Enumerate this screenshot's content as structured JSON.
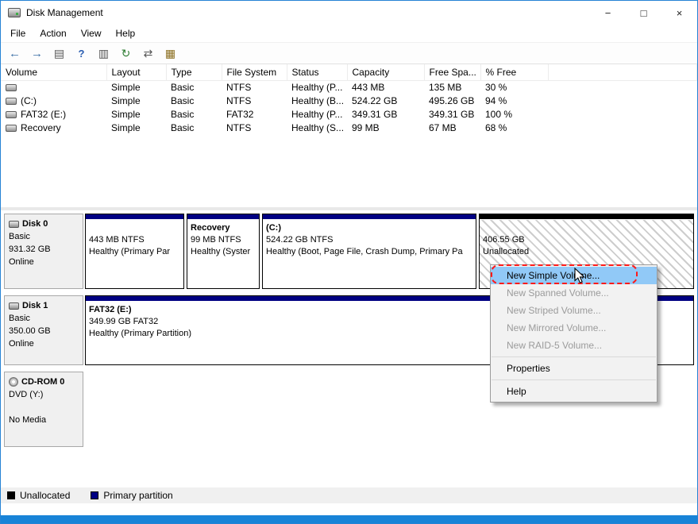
{
  "colors": {
    "accent": "#1883d7",
    "primary_partition": "#000082",
    "unallocated": "#000000",
    "menu_highlight": "#91c9f7",
    "annotation_red": "#ff1a1a"
  },
  "window": {
    "title": "Disk Management",
    "minimize": "−",
    "maximize": "□",
    "close": "×"
  },
  "menubar": {
    "items": [
      "File",
      "Action",
      "View",
      "Help"
    ]
  },
  "toolbar": {
    "icons": [
      {
        "name": "back-icon",
        "glyph": "←"
      },
      {
        "name": "forward-icon",
        "glyph": "→"
      },
      {
        "name": "show-console-tree-icon",
        "glyph": "▤"
      },
      {
        "name": "help-icon",
        "glyph": "?"
      },
      {
        "name": "show-action-pane-icon",
        "glyph": "▥"
      },
      {
        "name": "refresh-icon",
        "glyph": "↻"
      },
      {
        "name": "rescan-disks-icon",
        "glyph": "⇄"
      },
      {
        "name": "export-list-icon",
        "glyph": "▦"
      }
    ]
  },
  "volume_table": {
    "columns": [
      "Volume",
      "Layout",
      "Type",
      "File System",
      "Status",
      "Capacity",
      "Free Spa...",
      "% Free"
    ],
    "rows": [
      {
        "volume": "",
        "layout": "Simple",
        "type": "Basic",
        "file_system": "NTFS",
        "status": "Healthy (P...",
        "capacity": "443 MB",
        "free_space": "135 MB",
        "pct_free": "30 %"
      },
      {
        "volume": "(C:)",
        "layout": "Simple",
        "type": "Basic",
        "file_system": "NTFS",
        "status": "Healthy (B...",
        "capacity": "524.22 GB",
        "free_space": "495.26 GB",
        "pct_free": "94 %"
      },
      {
        "volume": "FAT32 (E:)",
        "layout": "Simple",
        "type": "Basic",
        "file_system": "FAT32",
        "status": "Healthy (P...",
        "capacity": "349.31 GB",
        "free_space": "349.31 GB",
        "pct_free": "100 %"
      },
      {
        "volume": "Recovery",
        "layout": "Simple",
        "type": "Basic",
        "file_system": "NTFS",
        "status": "Healthy (S...",
        "capacity": "99 MB",
        "free_space": "67 MB",
        "pct_free": "68 %"
      }
    ]
  },
  "disks": [
    {
      "name": "Disk 0",
      "info": [
        "Basic",
        "931.32 GB",
        "Online"
      ],
      "partitions": [
        {
          "label": "",
          "size": "443 MB NTFS",
          "status": "Healthy (Primary Par",
          "bar_color": "#000082"
        },
        {
          "label": "Recovery",
          "size": "99 MB NTFS",
          "status": "Healthy (Syster",
          "bar_color": "#000082"
        },
        {
          "label": "(C:)",
          "size": "524.22 GB NTFS",
          "status": "Healthy (Boot, Page File, Crash Dump, Primary Pa",
          "bar_color": "#000082"
        },
        {
          "label": "",
          "size": "406.55 GB",
          "status": "Unallocated",
          "bar_color": "#000000"
        }
      ]
    },
    {
      "name": "Disk 1",
      "info": [
        "Basic",
        "350.00 GB",
        "Online"
      ],
      "partitions": [
        {
          "label": "FAT32 (E:)",
          "size": "349.99 GB FAT32",
          "status": "Healthy (Primary Partition)",
          "bar_color": "#000082"
        }
      ]
    },
    {
      "name": "CD-ROM 0",
      "info": [
        "DVD (Y:)",
        "",
        "No Media"
      ],
      "partitions": []
    }
  ],
  "context_menu": {
    "items": [
      {
        "label": "New Simple Volume...",
        "state": "highlighted"
      },
      {
        "label": "New Spanned Volume...",
        "state": "disabled"
      },
      {
        "label": "New Striped Volume...",
        "state": "disabled"
      },
      {
        "label": "New Mirrored Volume...",
        "state": "disabled"
      },
      {
        "label": "New RAID-5 Volume...",
        "state": "disabled"
      },
      {
        "label": "Properties",
        "state": "normal"
      },
      {
        "label": "Help",
        "state": "normal"
      }
    ]
  },
  "legend": {
    "items": [
      {
        "label": "Unallocated",
        "color": "#000000"
      },
      {
        "label": "Primary partition",
        "color": "#000082"
      }
    ]
  }
}
